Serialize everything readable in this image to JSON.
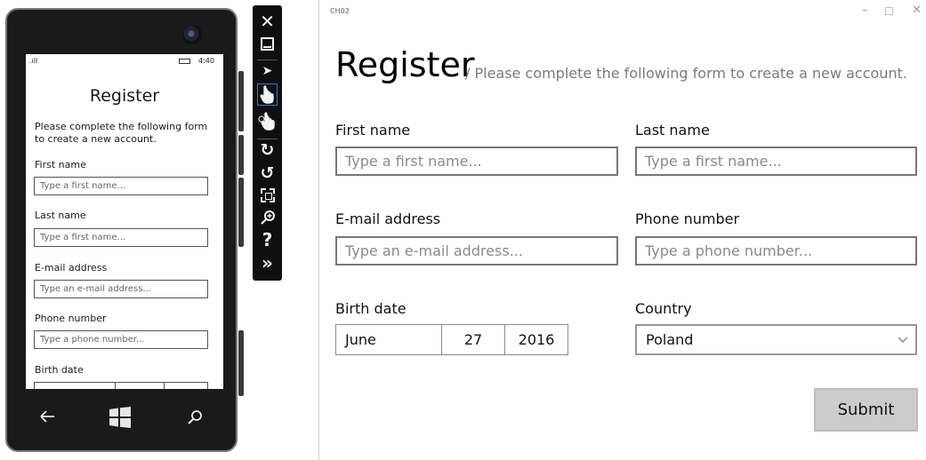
{
  "phone": {
    "status": {
      "signal": ".ıll",
      "time": "4:40"
    },
    "title": "Register",
    "description": "Please complete the following form to create a new account.",
    "fields": [
      {
        "label": "First name",
        "placeholder": "Type a first name..."
      },
      {
        "label": "Last name",
        "placeholder": "Type a first name..."
      },
      {
        "label": "E-mail address",
        "placeholder": "Type an e-mail address..."
      },
      {
        "label": "Phone number",
        "placeholder": "Type a phone number..."
      }
    ],
    "birth_date_label": "Birth date",
    "nav": {
      "back": "back-icon",
      "start": "windows-icon",
      "search": "search-icon"
    }
  },
  "toolbar": {
    "items": [
      "close",
      "minimize",
      "single-point-input",
      "touch-input",
      "pinch-zoom-input",
      "rotate-clockwise",
      "rotate-counterclockwise",
      "fit-to-screen",
      "zoom",
      "help",
      "tools"
    ]
  },
  "window": {
    "title": "CH02",
    "controls": {
      "minimize": "–",
      "maximize": "☐",
      "close": "✕"
    },
    "heading": "Register",
    "subheading": "/ Please complete the following form to create a new account.",
    "fields": {
      "first_name": {
        "label": "First name",
        "placeholder": "Type a first name..."
      },
      "last_name": {
        "label": "Last name",
        "placeholder": "Type a first name..."
      },
      "email": {
        "label": "E-mail address",
        "placeholder": "Type an e-mail address..."
      },
      "phone": {
        "label": "Phone number",
        "placeholder": "Type a phone number..."
      },
      "birth_date": {
        "label": "Birth date",
        "month": "June",
        "day": "27",
        "year": "2016"
      },
      "country": {
        "label": "Country",
        "value": "Poland"
      }
    },
    "submit_label": "Submit"
  }
}
